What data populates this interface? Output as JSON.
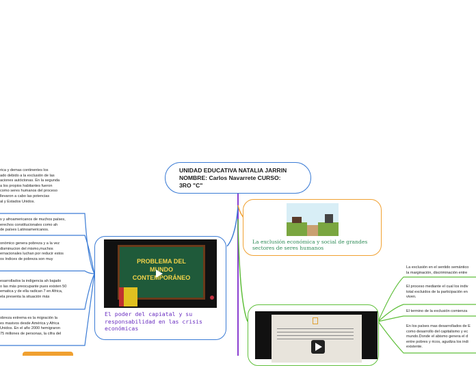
{
  "center": {
    "line1": "UNIDAD EDUCATIVA NATALIA JARRIN",
    "line2": "NOMBRE: Carlos Navarrete CURSO:",
    "line3": "3RO \"C\""
  },
  "topic_left": {
    "image_text_1": "PROBLEMA DEL",
    "image_text_2": "MUNDO",
    "image_text_3": "CONTEMPORÁNEO",
    "caption": "El poder del capiatal y su responsabilidad en las crisis económicas"
  },
  "topic_right_top": {
    "caption": "La exclusión económica y social de grandes sectores de seres humanos"
  },
  "topic_right_bottom": {
    "icon": "document-icon"
  },
  "left_leaves": [
    {
      "lines": [
        "rica y demas continentes los",
        "ado debido a la exclusión de las",
        "aciones autóctonas. En la segunda",
        "a los propios habitantes fueron",
        "como seres humanos del proceso",
        "llevaron a cabo las potencias",
        "al y Estados Unidos."
      ]
    },
    {
      "lines": [
        "s y afroamericanos de muchos países,",
        "erechos constitucionales como ah",
        "de países Latinoamericanos."
      ]
    },
    {
      "lines": [
        "onómico genera pobreza y a la vez",
        "disminucion del mismo,muchos",
        "ernacionales luchan por reducir estos",
        "os índices de pobreza son muy"
      ]
    },
    {
      "lines": [
        "esarrollados la indigencia ah bajado",
        "o las más preocupante pues existen 50",
        "ematica y de ella radican 7 en Africa,",
        "ela presenta la situación más"
      ]
    },
    {
      "lines": [
        "obreza extrema es la migración la",
        "es masivos desde América y Africa",
        "Unidos. En el año 2000 hemigraron",
        "75 millones de personas, la cifra del"
      ]
    }
  ],
  "right_leaves": [
    {
      "lines": [
        "La exclusión en el sentido semántico",
        "la marginación, discriminación entre"
      ]
    },
    {
      "lines": [
        "El proceso mediante el cual los indiv",
        "total excluidos de la participación en",
        "viven."
      ]
    },
    {
      "lines": [
        "El termino de la exclusión comienza"
      ]
    },
    {
      "lines": [
        "En los países mas desarrollados de E",
        "como desarrollo del capitalismo y ec",
        "mundo.Donde el abismo genera el d",
        "entre pobres y ricos, agudiza los indi",
        "existente."
      ]
    }
  ],
  "colors": {
    "center_border": "#3a7bd5",
    "left_branch": "#3a7bd5",
    "right_top_branch": "#f0a030",
    "right_bottom_branch": "#5fbf3a",
    "trunk": "#8a3fd0",
    "caption_green": "#2e8b57",
    "left_caption": "#6a2fc0"
  }
}
